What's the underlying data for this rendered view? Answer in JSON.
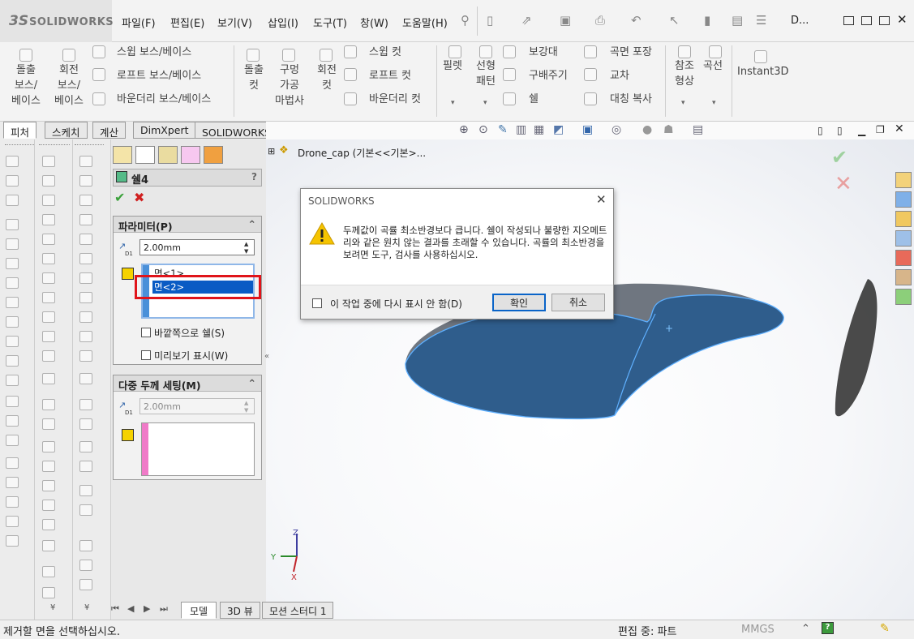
{
  "app": {
    "logo": "SOLIDWORKS",
    "logo_mark": "3S",
    "doc_short": "D..."
  },
  "menu": [
    "파일(F)",
    "편집(E)",
    "보기(V)",
    "삽입(I)",
    "도구(T)",
    "창(W)",
    "도움말(H)"
  ],
  "ribbon": {
    "extrude_boss": [
      "돌출",
      "보스/",
      "베이스"
    ],
    "revolve_boss": [
      "회전",
      "보스/",
      "베이스"
    ],
    "sweep_boss": "스윕 보스/베이스",
    "loft_boss": "로프트 보스/베이스",
    "boundary_boss": "바운더리 보스/베이스",
    "extrude_cut": [
      "돌출",
      "컷"
    ],
    "hole_wizard": [
      "구멍",
      "가공",
      "마법사"
    ],
    "revolve_cut": [
      "회전",
      "컷"
    ],
    "sweep_cut": "스윕 컷",
    "loft_cut": "로프트 컷",
    "boundary_cut": "바운더리 컷",
    "fillet": "필렛",
    "linear_pattern": [
      "선형",
      "패턴"
    ],
    "rib": "보강대",
    "draft": "구배주기",
    "shell": "쉘",
    "wrap": "곡면 포장",
    "intersect": "교차",
    "mirror": "대칭 복사",
    "ref_geometry": [
      "참조",
      "형상"
    ],
    "curves": "곡선",
    "instant3d": "Instant3D"
  },
  "tabs": [
    "피처",
    "스케치",
    "계산",
    "DimXpert",
    "SOLIDWORKS 애드인"
  ],
  "tree": {
    "root": "Drone_cap  (기본<<기본>..."
  },
  "pm": {
    "title": "쉘4",
    "help": "?",
    "params_title": "파라미터(P)",
    "thickness": "2.00mm",
    "face1": "면<1>",
    "face2": "면<2>",
    "shell_outward": "바깥쪽으로 쉘(S)",
    "preview": "미리보기 표시(W)",
    "multi_title": "다중 두께 세팅(M)",
    "multi_thickness": "2.00mm"
  },
  "dialog": {
    "title": "SOLIDWORKS",
    "message": "두께값이 곡률 최소반경보다 큽니다. 쉘이 작성되나 불량한 지오메트리와 같은 원치 않는 결과를 초래할 수 있습니다. 곡률의 최소반경을 보려면 도구, 검사를 사용하십시오.",
    "dont_show": "이 작업 중에 다시 표시 안 함(D)",
    "ok": "확인",
    "cancel": "취소"
  },
  "bottom_tabs": [
    "모델",
    "3D 뷰",
    "모션 스터디 1"
  ],
  "status": {
    "left": "제거할 면을 선택하십시오.",
    "mode": "편집 중: 파트",
    "units": "MMGS"
  },
  "triad": {
    "x": "X",
    "y": "Y",
    "z": "Z"
  },
  "colors": {
    "body": "#2f5d8c",
    "edge": "#5fb0ff",
    "accent": "#0a5bc4",
    "selection": "#e0141a"
  }
}
